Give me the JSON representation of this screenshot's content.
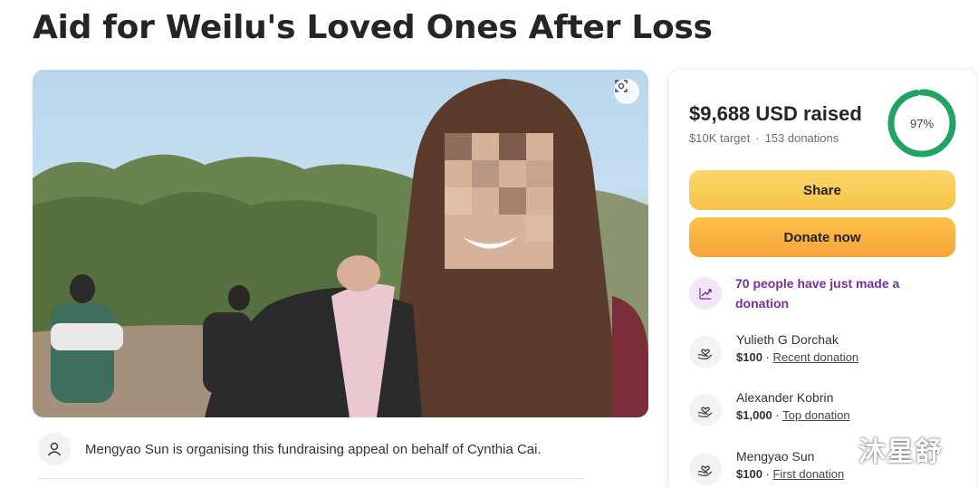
{
  "page": {
    "title": "Aid for Weilu's Loved Ones After Loss"
  },
  "organiser": {
    "text": "Mengyao Sun is organising this fundraising appeal on behalf of Cynthia Cai."
  },
  "progress": {
    "raised": "$9,688 USD raised",
    "target": "$10K target",
    "donations": "153 donations",
    "percent_label": "97%",
    "percent_value": 97
  },
  "buttons": {
    "share": "Share",
    "donate": "Donate now"
  },
  "activity": {
    "text": "70 people have just made a donation"
  },
  "donors": [
    {
      "name": "Yulieth G Dorchak",
      "amount": "$100",
      "tag": "Recent donation"
    },
    {
      "name": "Alexander Kobrin",
      "amount": "$1,000",
      "tag": "Top donation"
    },
    {
      "name": "Mengyao Sun",
      "amount": "$100",
      "tag": "First donation"
    }
  ],
  "watermark": "沐星舒",
  "colors": {
    "ring": "#1fa463",
    "share_button": "#f6c348",
    "donate_button": "#f8a33a",
    "activity_text": "#7a2e9c"
  },
  "icons": {
    "expand": "expand-icon",
    "organiser": "user-icon",
    "activity": "trending-up-icon",
    "donor": "heart-hand-icon"
  }
}
